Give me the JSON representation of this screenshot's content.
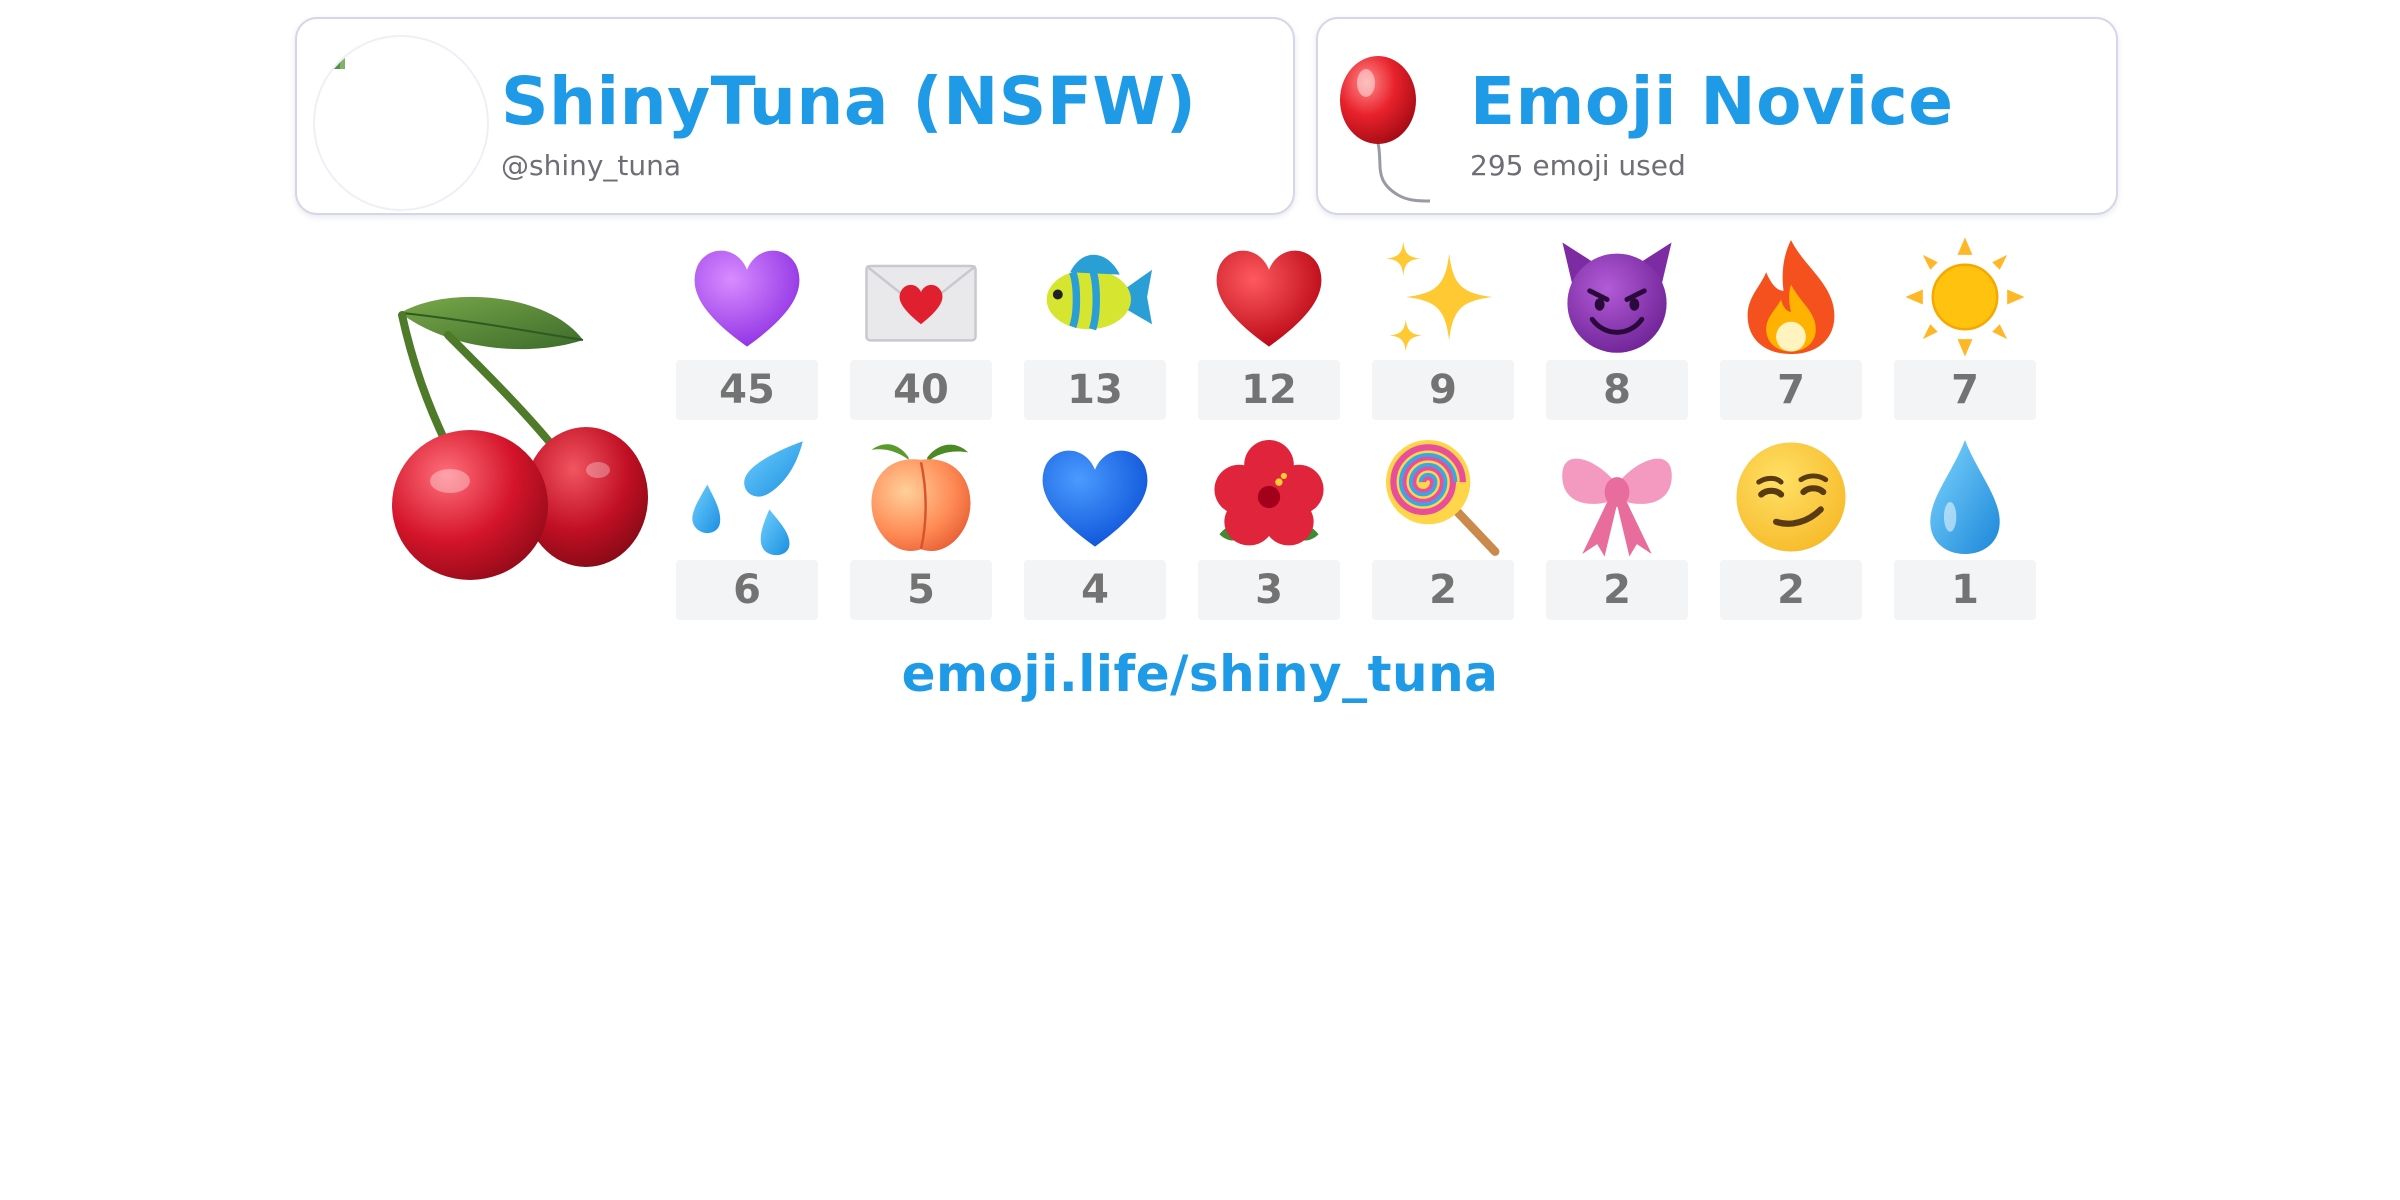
{
  "profile": {
    "display_name": "ShinyTuna (NSFW)",
    "handle": "@shiny_tuna",
    "avatar_icon": "avatar-image"
  },
  "rank": {
    "title": "Emoji Novice",
    "subtitle": "295 emoji used",
    "icon": "balloon-icon"
  },
  "featured_icon": "cherries-icon",
  "emoji_stats": [
    {
      "icon": "purple-heart-icon",
      "count": "45"
    },
    {
      "icon": "love-letter-icon",
      "count": "40"
    },
    {
      "icon": "tropical-fish-icon",
      "count": "13"
    },
    {
      "icon": "red-heart-icon",
      "count": "12"
    },
    {
      "icon": "sparkles-icon",
      "count": "9"
    },
    {
      "icon": "smiling-devil-icon",
      "count": "8"
    },
    {
      "icon": "fire-icon",
      "count": "7"
    },
    {
      "icon": "sun-icon",
      "count": "7"
    },
    {
      "icon": "sweat-droplets-icon",
      "count": "6"
    },
    {
      "icon": "peach-icon",
      "count": "5"
    },
    {
      "icon": "blue-heart-icon",
      "count": "4"
    },
    {
      "icon": "hibiscus-icon",
      "count": "3"
    },
    {
      "icon": "lollipop-icon",
      "count": "2"
    },
    {
      "icon": "ribbon-icon",
      "count": "2"
    },
    {
      "icon": "smirking-face-icon",
      "count": "2"
    },
    {
      "icon": "droplet-icon",
      "count": "1"
    }
  ],
  "footer": {
    "link_text": "emoji.life/shiny_tuna"
  },
  "colors": {
    "accent": "#1f9ae6",
    "count_text": "#737373",
    "count_bg": "#f3f4f6",
    "card_border": "#d3d7e6"
  }
}
